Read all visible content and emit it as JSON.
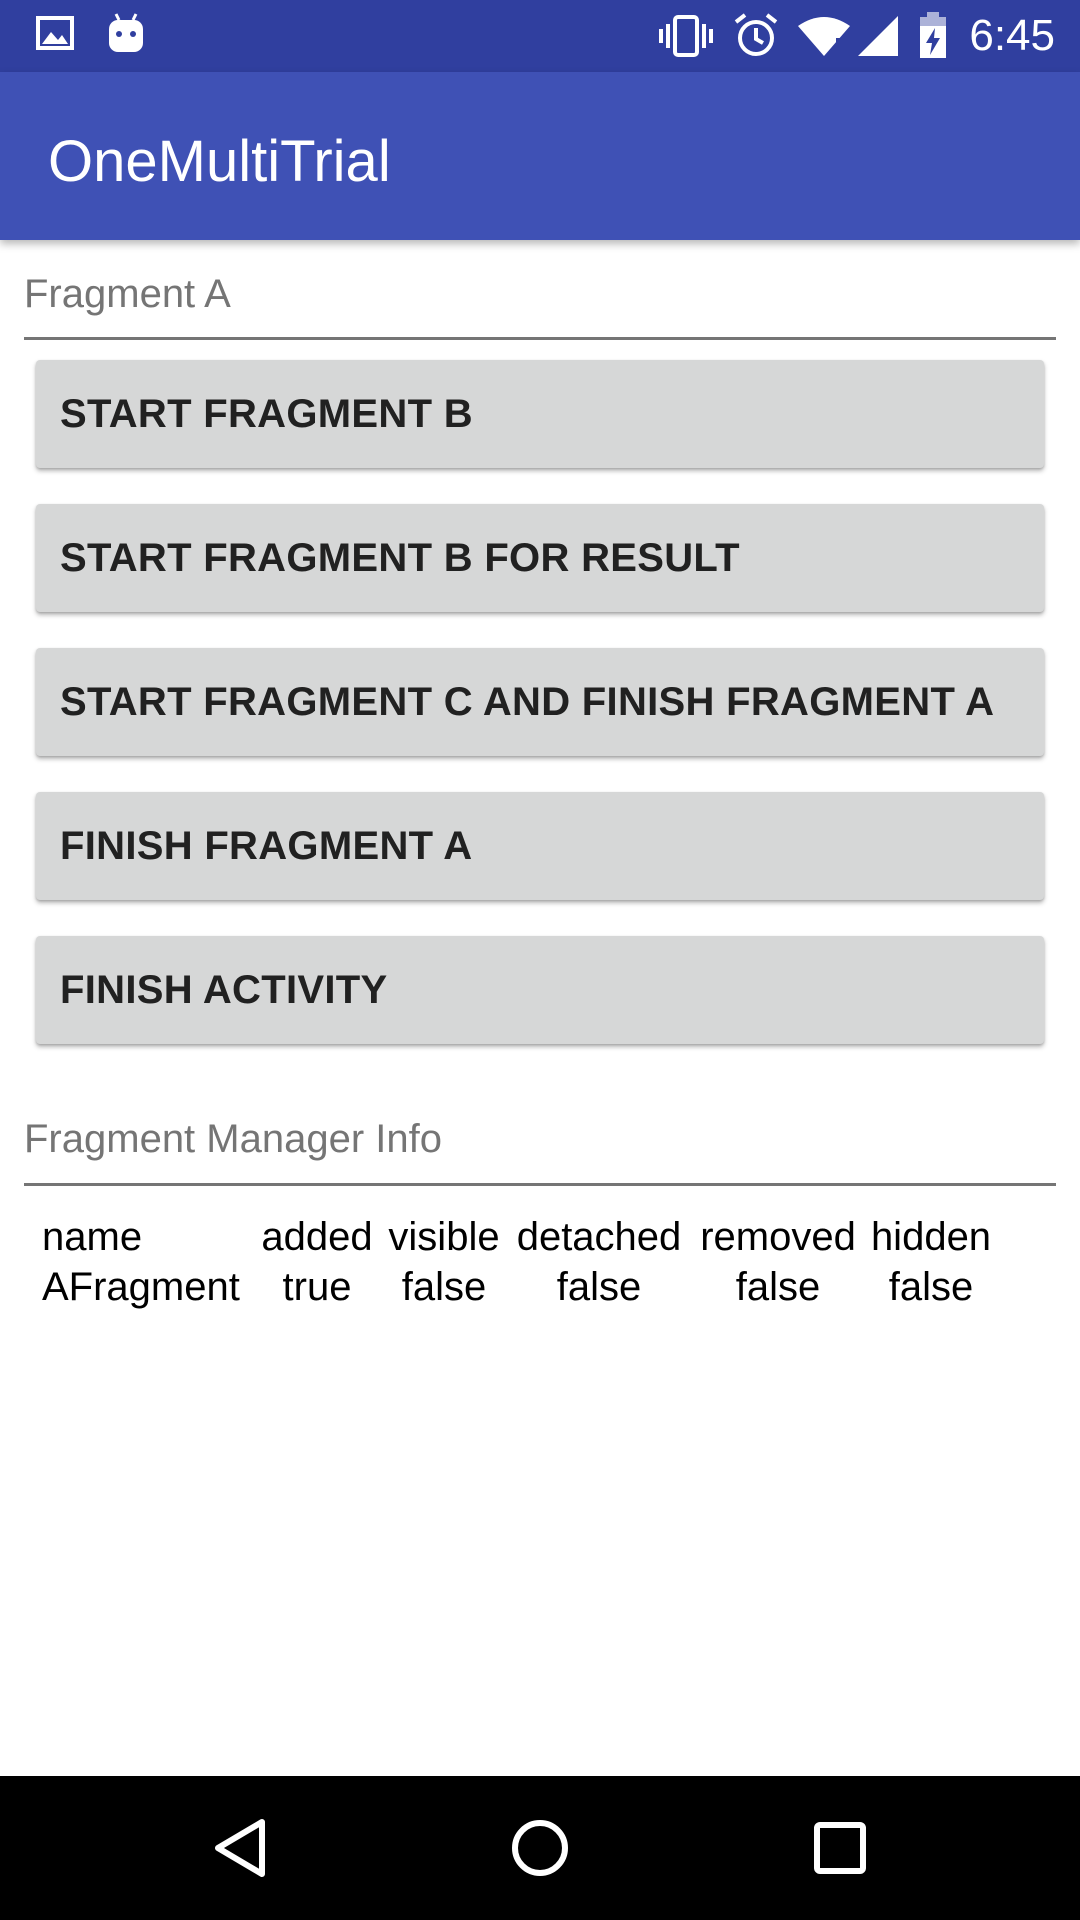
{
  "status_bar": {
    "time": "6:45",
    "left_icons": [
      "image-icon",
      "android-icon"
    ],
    "right_icons": [
      "vibrate-icon",
      "alarm-icon",
      "wifi-icon",
      "signal-icon",
      "battery-charging-icon"
    ],
    "background_color": "#303f9f"
  },
  "toolbar": {
    "title": "OneMultiTrial",
    "background_color": "#3f51b5"
  },
  "fragment_section": {
    "header": "Fragment A",
    "buttons": [
      {
        "label": "START FRAGMENT B"
      },
      {
        "label": "START FRAGMENT B FOR RESULT"
      },
      {
        "label": "START FRAGMENT C AND FINISH FRAGMENT A"
      },
      {
        "label": "FINISH FRAGMENT A"
      },
      {
        "label": "FINISH ACTIVITY"
      }
    ]
  },
  "manager_section": {
    "header": "Fragment Manager Info",
    "columns": [
      "name",
      "added",
      "visible",
      "detached",
      "removed",
      "hidden"
    ],
    "rows": [
      [
        "AFragment",
        "true",
        "false",
        "false",
        "false",
        "false"
      ]
    ]
  },
  "nav_bar": {
    "icons": [
      "back-icon",
      "home-icon",
      "recents-icon"
    ]
  }
}
